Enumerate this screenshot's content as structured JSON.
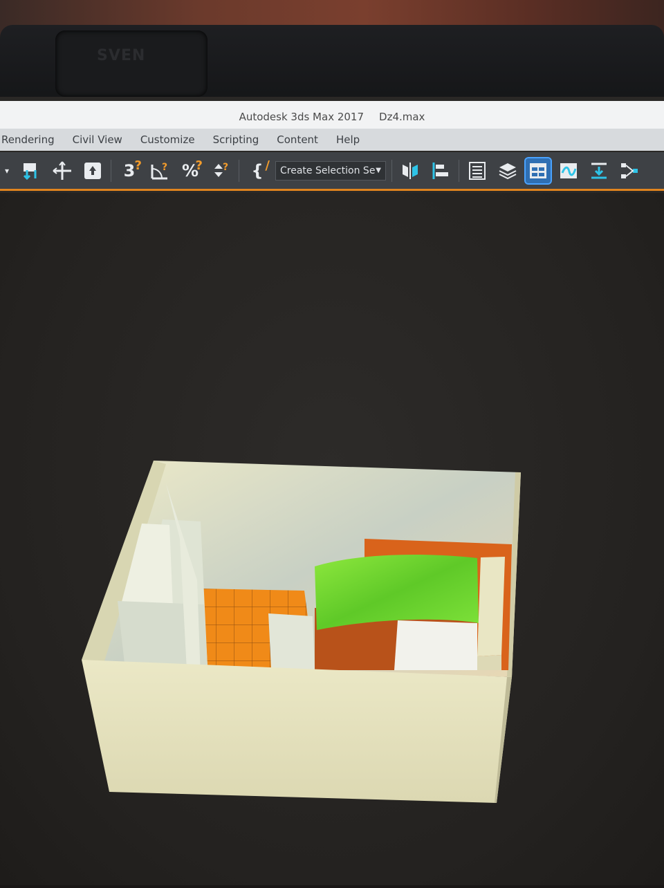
{
  "window": {
    "app_title": "Autodesk 3ds Max 2017",
    "file_name": "Dz4.max"
  },
  "menu": {
    "items": [
      "Rendering",
      "Civil View",
      "Customize",
      "Scripting",
      "Content",
      "Help"
    ]
  },
  "toolbar": {
    "selection_set_label": "Create Selection Se",
    "icons": [
      "select-link-icon",
      "move-icon",
      "select-filter-icon",
      "snap-3d-icon",
      "angle-snap-icon",
      "percent-snap-icon",
      "spinner-snap-icon",
      "named-selection-icon",
      "mirror-icon",
      "align-icon",
      "scene-explorer-icon",
      "layer-explorer-icon",
      "ribbon-toggle-icon",
      "curve-editor-icon",
      "render-setup-icon",
      "schematic-view-icon"
    ]
  },
  "monitor": {
    "brand": "SVEN"
  },
  "colors": {
    "wall": "#e6e3bf",
    "floor": "#f08a18",
    "bed_cover": "#7fe23a",
    "bed_frame": "#d9631b",
    "toolbar_accent": "#e0841e"
  }
}
